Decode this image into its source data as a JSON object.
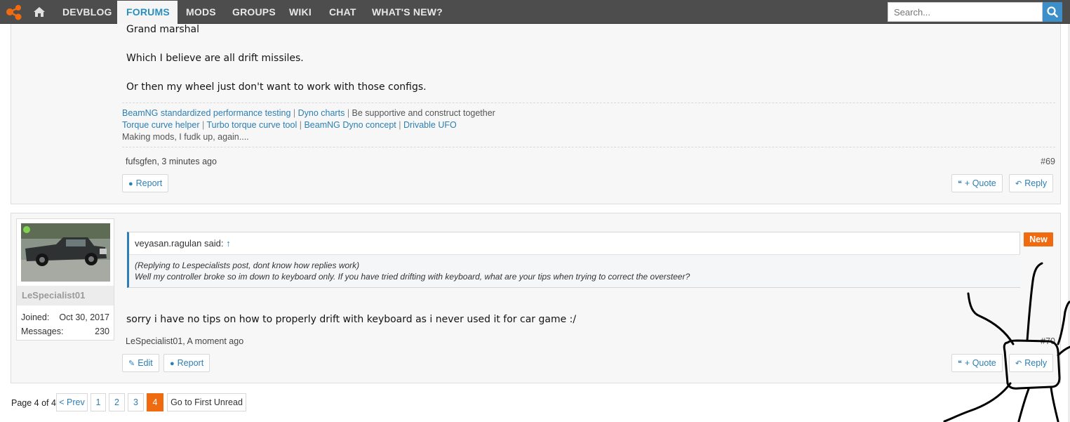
{
  "nav": {
    "items": [
      "DEVBLOG",
      "FORUMS",
      "MODS",
      "GROUPS",
      "WIKI",
      "CHAT",
      "WHAT'S NEW?"
    ],
    "active": "FORUMS",
    "search_placeholder": "Search..."
  },
  "post1": {
    "lines": [
      "Grand marshal",
      "Which I believe are all drift missiles.",
      "Or then my wheel just don't want to work with those configs."
    ],
    "signature": {
      "line1_links": [
        "BeamNG standardized performance testing",
        "Dyno charts"
      ],
      "line1_text": "Be supportive and construct together",
      "line2_links": [
        "Torque curve helper",
        "Turbo torque curve tool",
        "BeamNG Dyno concept",
        "Drivable UFO"
      ],
      "line3_text": "Making mods, I fudk up, again...."
    },
    "meta": "fufsgfen, 3 minutes ago",
    "number": "#69",
    "report_label": "Report",
    "quote_label": "+ Quote",
    "reply_label": "Reply"
  },
  "post2": {
    "user": {
      "name": "LeSpecialist01",
      "joined_label": "Joined:",
      "joined_value": "Oct 30, 2017",
      "messages_label": "Messages:",
      "messages_value": "230"
    },
    "quote": {
      "author": "veyasan.ragulan said:",
      "arrow": "↑",
      "line1": "(Replying to Lespecialists post, dont know how replies work)",
      "line2": "Well my controller broke so im down to keyboard only. If you have tried drifting with keyboard, what are your tips when trying to correct the oversteer?"
    },
    "new_badge": "New",
    "text": "sorry i have no tips on how to properly drift with keyboard as i never used it for car game :/",
    "meta": "LeSpecialist01, A moment ago",
    "number": "#70",
    "edit_label": "Edit",
    "report_label": "Report",
    "quote_label": "+ Quote",
    "reply_label": "Reply"
  },
  "pagination": {
    "label": "Page 4 of 4",
    "prev": "< Prev",
    "pages": [
      "1",
      "2",
      "3",
      "4"
    ],
    "current": "4",
    "first_unread": "Go to First Unread"
  }
}
